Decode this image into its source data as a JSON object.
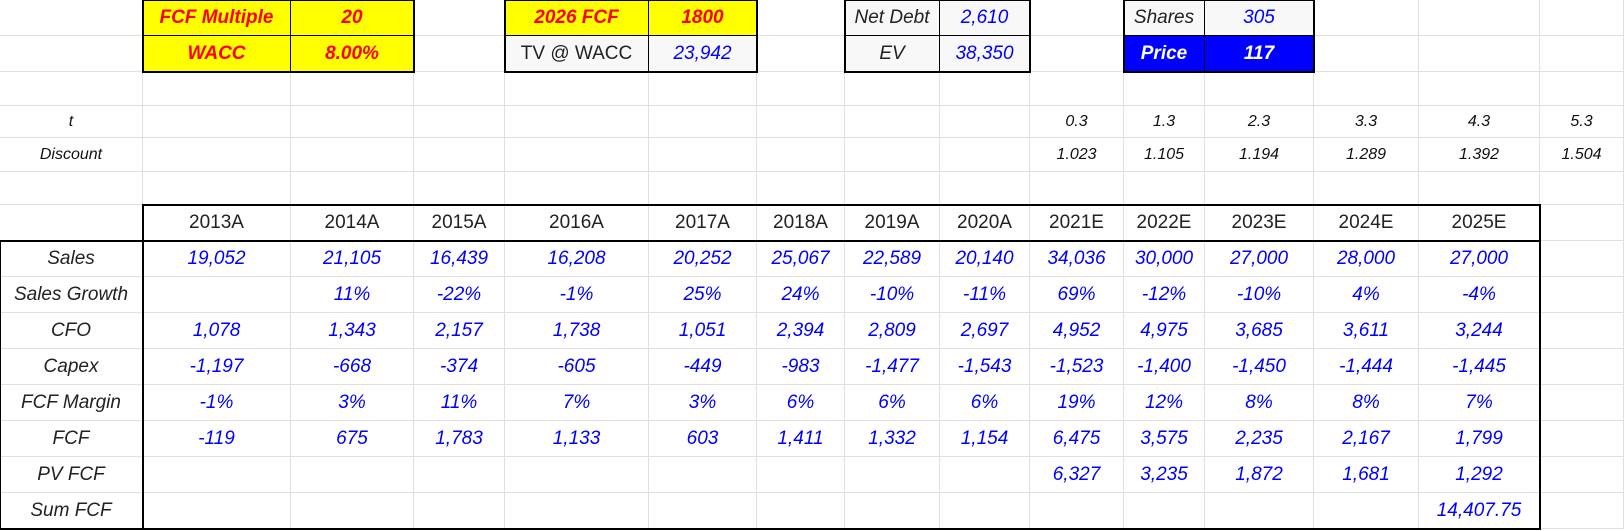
{
  "assumptions": {
    "fcf_multiple_label": "FCF Multiple",
    "fcf_multiple": "20",
    "wacc_label": "WACC",
    "wacc": "8.00%",
    "fcf_2026_label": "2026 FCF",
    "fcf_2026": "1800",
    "tv_label": "TV @ WACC",
    "tv": "23,942",
    "net_debt_label": "Net Debt",
    "net_debt": "2,610",
    "ev_label": "EV",
    "ev": "38,350",
    "shares_label": "Shares",
    "shares": "305",
    "price_label": "Price",
    "price": "117"
  },
  "timing": {
    "t_label": "t",
    "t_values": [
      "0.3",
      "1.3",
      "2.3",
      "3.3",
      "4.3",
      "5.3"
    ],
    "discount_label": "Discount",
    "discount_values": [
      "1.023",
      "1.105",
      "1.194",
      "1.289",
      "1.392",
      "1.504"
    ]
  },
  "table": {
    "years": [
      "2013A",
      "2014A",
      "2015A",
      "2016A",
      "2017A",
      "2018A",
      "2019A",
      "2020A",
      "2021E",
      "2022E",
      "2023E",
      "2024E",
      "2025E"
    ],
    "rows": [
      {
        "label": "Sales",
        "values": [
          "19,052",
          "21,105",
          "16,439",
          "16,208",
          "20,252",
          "25,067",
          "22,589",
          "20,140",
          "34,036",
          "30,000",
          "27,000",
          "28,000",
          "27,000"
        ]
      },
      {
        "label": "Sales Growth",
        "values": [
          "",
          "11%",
          "-22%",
          "-1%",
          "25%",
          "24%",
          "-10%",
          "-11%",
          "69%",
          "-12%",
          "-10%",
          "4%",
          "-4%"
        ]
      },
      {
        "label": "CFO",
        "values": [
          "1,078",
          "1,343",
          "2,157",
          "1,738",
          "1,051",
          "2,394",
          "2,809",
          "2,697",
          "4,952",
          "4,975",
          "3,685",
          "3,611",
          "3,244"
        ]
      },
      {
        "label": "Capex",
        "values": [
          "-1,197",
          "-668",
          "-374",
          "-605",
          "-449",
          "-983",
          "-1,477",
          "-1,543",
          "-1,523",
          "-1,400",
          "-1,450",
          "-1,444",
          "-1,445"
        ]
      },
      {
        "label": "FCF Margin",
        "values": [
          "-1%",
          "3%",
          "11%",
          "7%",
          "3%",
          "6%",
          "6%",
          "6%",
          "19%",
          "12%",
          "8%",
          "8%",
          "7%"
        ]
      },
      {
        "label": "FCF",
        "values": [
          "-119",
          "675",
          "1,783",
          "1,133",
          "603",
          "1,411",
          "1,332",
          "1,154",
          "6,475",
          "3,575",
          "2,235",
          "2,167",
          "1,799"
        ]
      },
      {
        "label": "PV FCF",
        "values": [
          "",
          "",
          "",
          "",
          "",
          "",
          "",
          "",
          "6,327",
          "3,235",
          "1,872",
          "1,681",
          "1,292"
        ]
      },
      {
        "label": "Sum FCF",
        "values": [
          "",
          "",
          "",
          "",
          "",
          "",
          "",
          "",
          "",
          "",
          "",
          "",
          "14,407.75"
        ]
      }
    ]
  },
  "colors": {
    "input_fill": "#ffff00",
    "input_text": "#ff0000",
    "value_text": "#0000ff",
    "price_fill": "#0000ff"
  }
}
